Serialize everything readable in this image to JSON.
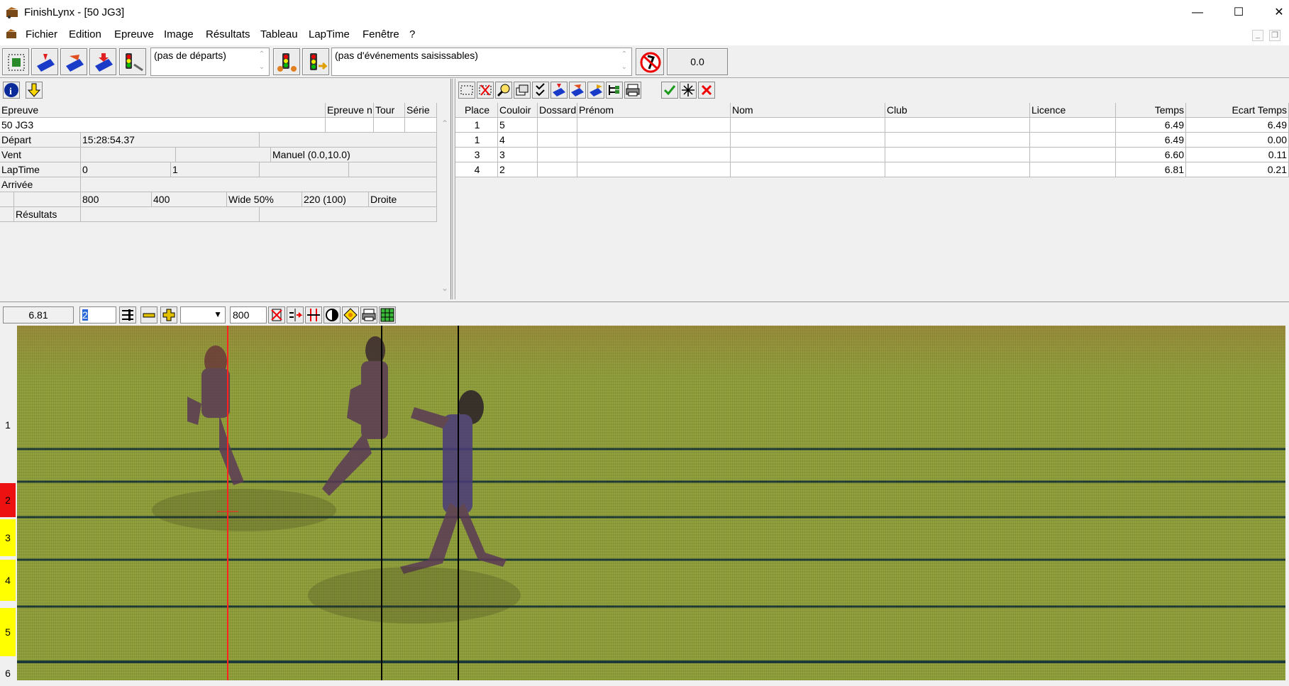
{
  "window": {
    "title": "FinishLynx - [50 JG3]",
    "minimize": "—",
    "maximize": "☐",
    "close": "✕"
  },
  "menu": [
    "Fichier",
    "Edition",
    "Epreuve",
    "Image",
    "Résultats",
    "Tableau",
    "LapTime",
    "Fenêtre",
    "?"
  ],
  "toolbar": {
    "departs_combo": "(pas de départs)",
    "events_combo": "(pas d'événements saisissables)",
    "time_display": "0.0"
  },
  "event_grid": {
    "headers": [
      "Epreuve",
      "Epreuve n",
      "Tour",
      "Série"
    ],
    "event_name": "50 JG3",
    "rows": [
      {
        "label": "Départ",
        "v1": "15:28:54.37"
      },
      {
        "label": "Vent",
        "v3": "Manuel (0.0,10.0)"
      },
      {
        "label": "LapTime",
        "v1": "0",
        "v2": "1"
      },
      {
        "label": "Arrivée"
      },
      {
        "label": "",
        "c1": "800",
        "c2": "400",
        "c3": "Wide 50%",
        "c4": "220  (100)",
        "c5": "Droite"
      },
      {
        "label": "Résultats"
      }
    ]
  },
  "results_grid": {
    "headers": [
      "Place",
      "Couloir",
      "Dossard",
      "Prénom",
      "Nom",
      "Club",
      "Licence",
      "Temps",
      "Ecart Temps"
    ],
    "rows": [
      {
        "place": "1",
        "lane": "5",
        "time": "6.49",
        "gap": "6.49"
      },
      {
        "place": "1",
        "lane": "4",
        "time": "6.49",
        "gap": "0.00"
      },
      {
        "place": "3",
        "lane": "3",
        "time": "6.60",
        "gap": "0.11"
      },
      {
        "place": "4",
        "lane": "2",
        "time": "6.81",
        "gap": "0.21"
      }
    ]
  },
  "image_toolbar": {
    "cursor_time": "6.81",
    "lane_field": "2",
    "width_field": "800"
  },
  "lanes": [
    "1",
    "2",
    "3",
    "4",
    "5",
    "6"
  ],
  "colors": {
    "lane_selected": "#ee1111",
    "lane_highlight": "#ffff00",
    "cursor_line": "#ff2020",
    "photo_base": "#8a9a3a"
  }
}
